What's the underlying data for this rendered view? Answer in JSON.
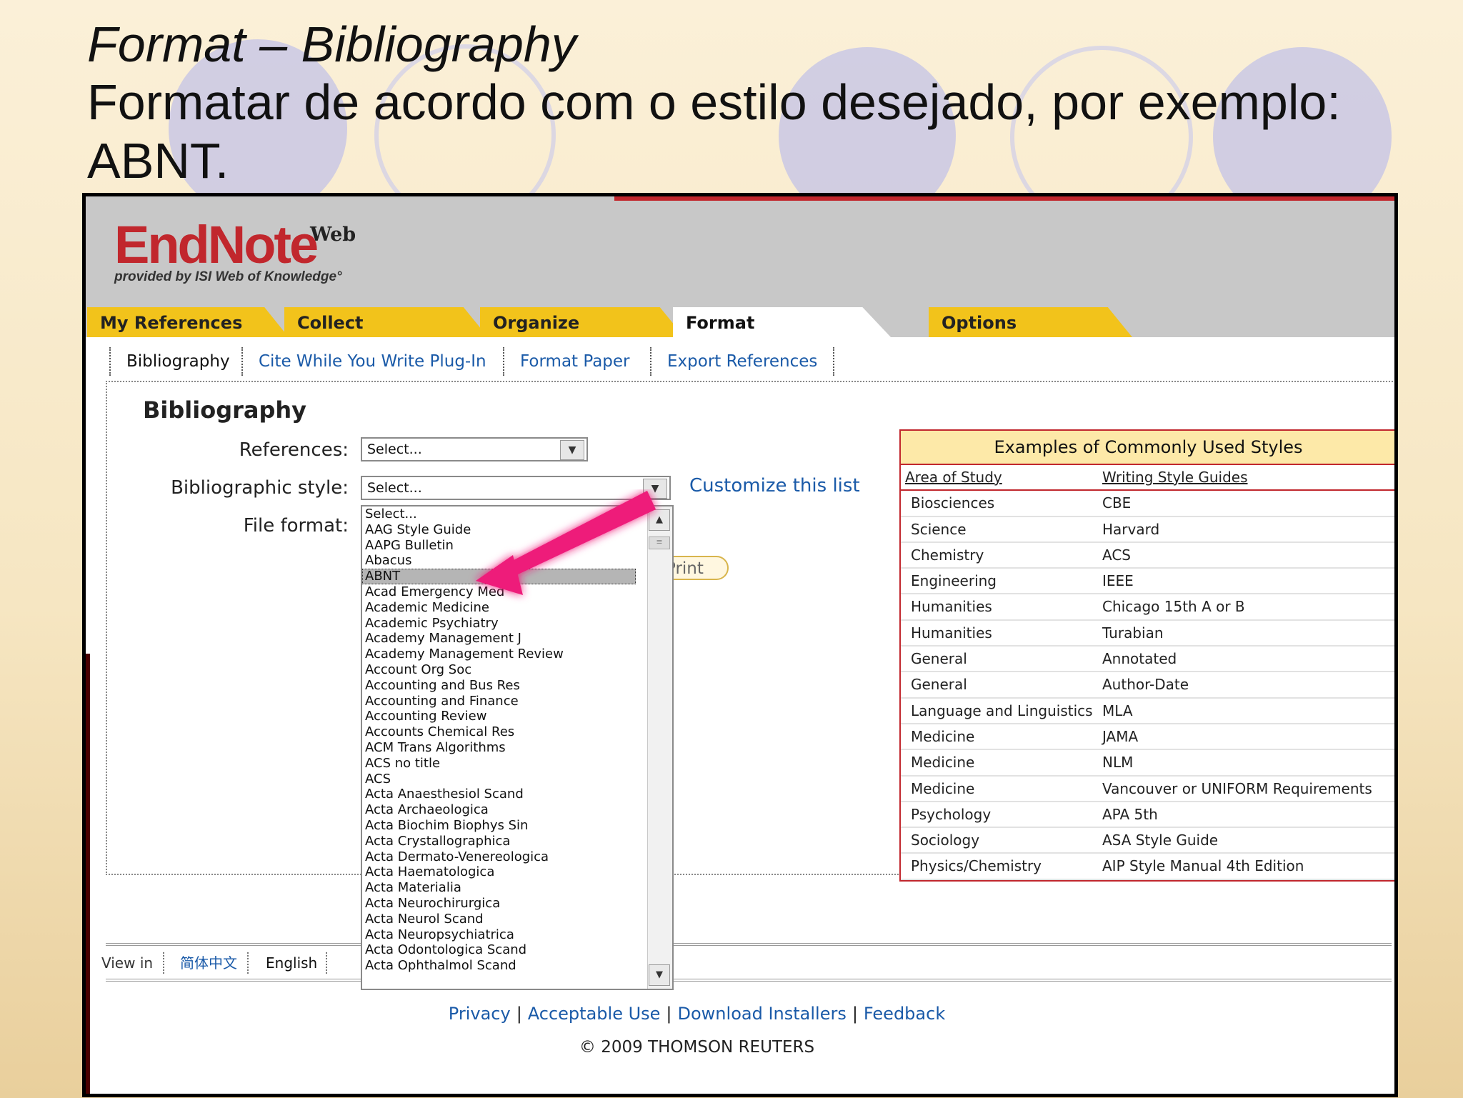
{
  "slide": {
    "title_italic": "Format – Bibliography",
    "title_line2": "Formatar de acordo com o estilo desejado, por exemplo:",
    "title_line3": "ABNT."
  },
  "app": {
    "logo": "EndNote",
    "logo_sup": "Web",
    "logo_sub": "provided by ISI Web of Knowledge°",
    "tabs": [
      "My References",
      "Collect",
      "Organize",
      "Format",
      "Options"
    ],
    "active_tab": "Format",
    "subnav": [
      "Bibliography",
      "Cite While You Write Plug-In",
      "Format Paper",
      "Export References"
    ]
  },
  "form": {
    "heading": "Bibliography",
    "references_label": "References:",
    "references_value": "Select...",
    "style_label": "Bibliographic style:",
    "style_value": "Select...",
    "file_format_label": "File format:",
    "customize_link": "Customize this list",
    "print_button": "Print"
  },
  "dropdown": {
    "options": [
      "Select...",
      "AAG Style Guide",
      "AAPG Bulletin",
      "Abacus",
      "ABNT",
      "Acad Emergency Med",
      "Academic Medicine",
      "Academic Psychiatry",
      "Academy Management J",
      "Academy Management Review",
      "Account Org Soc",
      "Accounting and Bus Res",
      "Accounting and Finance",
      "Accounting Review",
      "Accounts Chemical Res",
      "ACM Trans Algorithms",
      "ACS no title",
      "ACS",
      "Acta Anaesthesiol Scand",
      "Acta Archaeologica",
      "Acta Biochim Biophys Sin",
      "Acta Crystallographica",
      "Acta Dermato-Venereologica",
      "Acta Haematologica",
      "Acta Materialia",
      "Acta Neurochirurgica",
      "Acta Neurol Scand",
      "Acta Neuropsychiatrica",
      "Acta Odontologica Scand",
      "Acta Ophthalmol Scand"
    ],
    "highlighted": "ABNT"
  },
  "examples": {
    "title": "Examples of Commonly Used Styles",
    "col1": "Area of Study",
    "col2": "Writing Style Guides",
    "rows": [
      [
        "Biosciences",
        "CBE"
      ],
      [
        "Science",
        "Harvard"
      ],
      [
        "Chemistry",
        "ACS"
      ],
      [
        "Engineering",
        "IEEE"
      ],
      [
        "Humanities",
        "Chicago 15th A or B"
      ],
      [
        "Humanities",
        "Turabian"
      ],
      [
        "General",
        "Annotated"
      ],
      [
        "General",
        "Author-Date"
      ],
      [
        "Language and Linguistics",
        "MLA"
      ],
      [
        "Medicine",
        "JAMA"
      ],
      [
        "Medicine",
        "NLM"
      ],
      [
        "Medicine",
        "Vancouver or UNIFORM Requirements"
      ],
      [
        "Psychology",
        "APA 5th"
      ],
      [
        "Sociology",
        "ASA Style Guide"
      ],
      [
        "Physics/Chemistry",
        "AIP Style Manual 4th Edition"
      ]
    ]
  },
  "footer": {
    "view_in": "View in",
    "lang_chinese": "简体中文",
    "lang_english": "English",
    "links": [
      "Privacy",
      "Acceptable Use",
      "Download Installers",
      "Feedback"
    ],
    "copyright": "© 2009 THOMSON REUTERS"
  },
  "colors": {
    "tab_yellow": "#f2c31b",
    "brand_red": "#c1272d",
    "link_blue": "#1a5aa8",
    "arrow_pink": "#ee1d7a"
  }
}
